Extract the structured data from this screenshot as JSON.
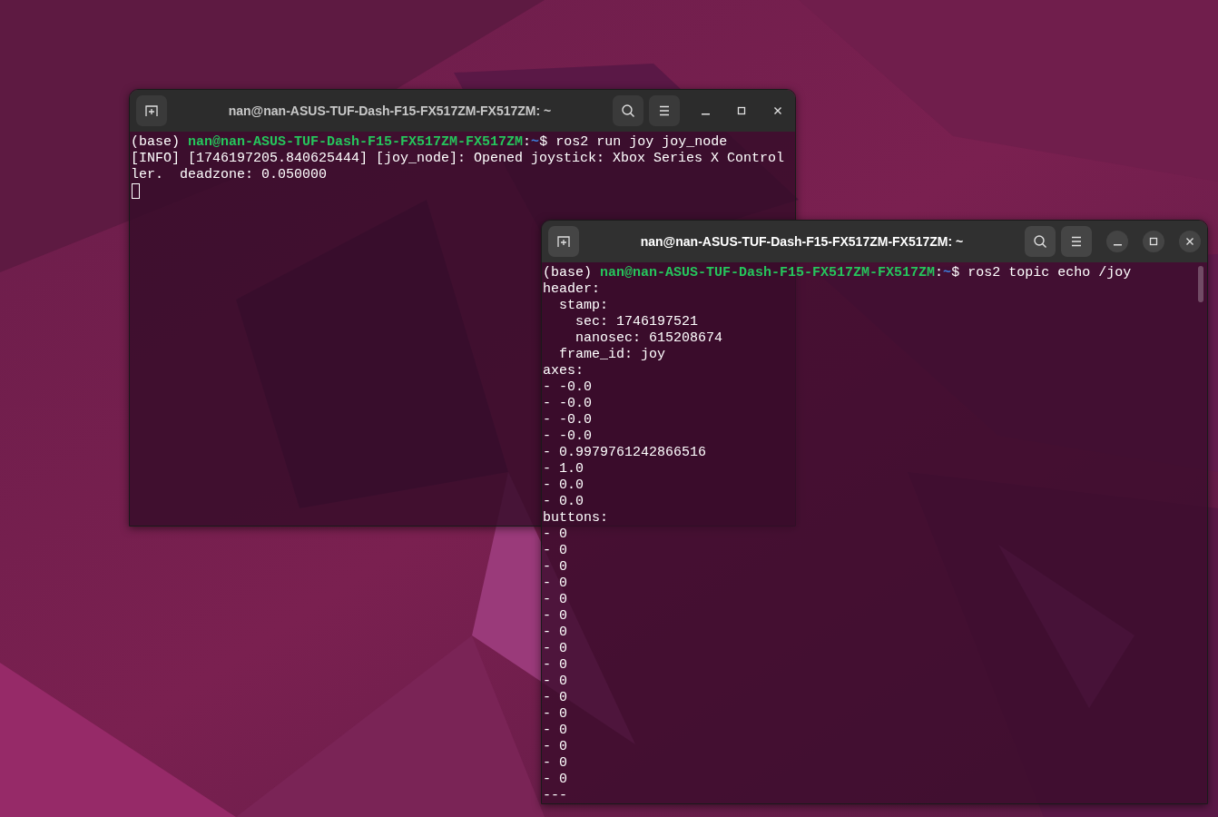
{
  "windows": [
    {
      "title": "nan@nan-ASUS-TUF-Dash-F15-FX517ZM-FX517ZM: ~",
      "focused": false,
      "cursor": true,
      "lines": [
        {
          "kind": "prompt",
          "env": "(base)",
          "user_host": "nan@nan-ASUS-TUF-Dash-F15-FX517ZM-FX517ZM",
          "separator": ":",
          "path": "~",
          "symbol": "$",
          "command": "ros2 run joy joy_node"
        },
        {
          "kind": "output",
          "text": "[INFO] [1746197205.840625444] [joy_node]: Opened joystick: Xbox Series X Control"
        },
        {
          "kind": "output",
          "text": "ler.  deadzone: 0.050000"
        }
      ]
    },
    {
      "title": "nan@nan-ASUS-TUF-Dash-F15-FX517ZM-FX517ZM: ~",
      "focused": true,
      "lines": [
        {
          "kind": "prompt",
          "env": "(base)",
          "user_host": "nan@nan-ASUS-TUF-Dash-F15-FX517ZM-FX517ZM",
          "separator": ":",
          "path": "~",
          "symbol": "$",
          "command": "ros2 topic echo /joy"
        },
        {
          "kind": "output",
          "text": "header:"
        },
        {
          "kind": "output",
          "text": "  stamp:"
        },
        {
          "kind": "output",
          "text": "    sec: 1746197521"
        },
        {
          "kind": "output",
          "text": "    nanosec: 615208674"
        },
        {
          "kind": "output",
          "text": "  frame_id: joy"
        },
        {
          "kind": "output",
          "text": "axes:"
        },
        {
          "kind": "output",
          "text": "- -0.0"
        },
        {
          "kind": "output",
          "text": "- -0.0"
        },
        {
          "kind": "output",
          "text": "- -0.0"
        },
        {
          "kind": "output",
          "text": "- -0.0"
        },
        {
          "kind": "output",
          "text": "- 0.9979761242866516"
        },
        {
          "kind": "output",
          "text": "- 1.0"
        },
        {
          "kind": "output",
          "text": "- 0.0"
        },
        {
          "kind": "output",
          "text": "- 0.0"
        },
        {
          "kind": "output",
          "text": "buttons:"
        },
        {
          "kind": "output",
          "text": "- 0"
        },
        {
          "kind": "output",
          "text": "- 0"
        },
        {
          "kind": "output",
          "text": "- 0"
        },
        {
          "kind": "output",
          "text": "- 0"
        },
        {
          "kind": "output",
          "text": "- 0"
        },
        {
          "kind": "output",
          "text": "- 0"
        },
        {
          "kind": "output",
          "text": "- 0"
        },
        {
          "kind": "output",
          "text": "- 0"
        },
        {
          "kind": "output",
          "text": "- 0"
        },
        {
          "kind": "output",
          "text": "- 0"
        },
        {
          "kind": "output",
          "text": "- 0"
        },
        {
          "kind": "output",
          "text": "- 0"
        },
        {
          "kind": "output",
          "text": "- 0"
        },
        {
          "kind": "output",
          "text": "- 0"
        },
        {
          "kind": "output",
          "text": "- 0"
        },
        {
          "kind": "output",
          "text": "- 0"
        },
        {
          "kind": "output",
          "text": "---"
        }
      ]
    }
  ]
}
